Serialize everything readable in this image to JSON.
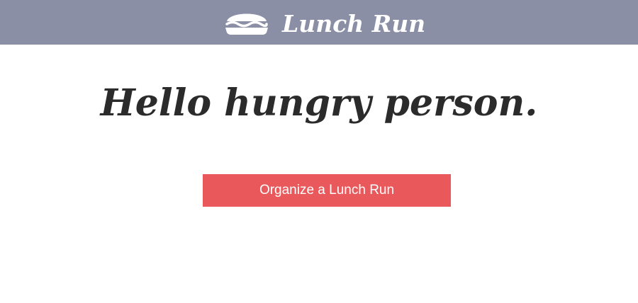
{
  "header": {
    "title": "Lunch Run",
    "icon": "sandwich-icon",
    "background_color": "#8a8fa6"
  },
  "main": {
    "headline": "Hello hungry person.",
    "cta_label": "Organize a Lunch Run",
    "cta_color": "#e9595c"
  }
}
